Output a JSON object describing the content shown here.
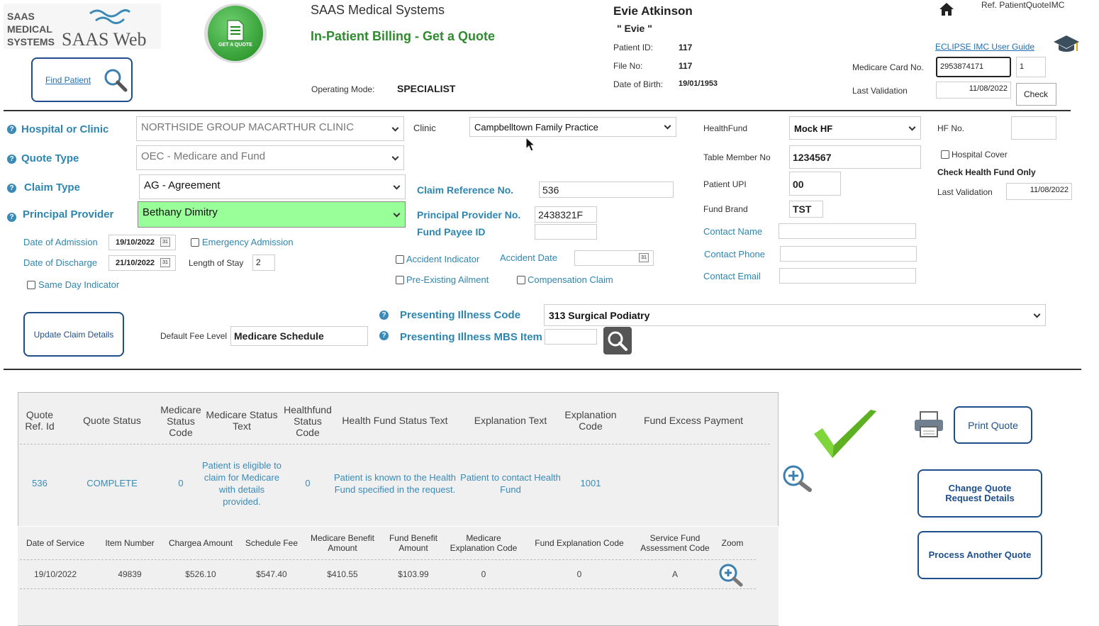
{
  "branding": {
    "logo_line1": "SAAS",
    "logo_line2": "MEDICAL",
    "logo_line3": "SYSTEMS",
    "logo_web": "SAAS Web",
    "badge_text": "GET A QUOTE"
  },
  "header": {
    "company": "SAAS Medical Systems",
    "page_title": "In-Patient Billing - Get a Quote",
    "operating_mode_label": "Operating Mode:",
    "operating_mode": "SPECIALIST",
    "find_patient": "Find Patient",
    "ref": "Ref. PatientQuoteIMC",
    "user_guide": "ECLIPSE IMC User Guide"
  },
  "patient": {
    "name": "Evie Atkinson",
    "nickname": "\" Evie \"",
    "id_label": "Patient ID:",
    "id": "117",
    "file_label": "File No:",
    "file": "117",
    "dob_label": "Date of Birth:",
    "dob": "19/01/1953",
    "medicare_label": "Medicare Card No.",
    "medicare": "2953874171",
    "medicare_irn": "1",
    "last_validation_label": "Last Validation",
    "last_validation": "11/08/2022",
    "check_label": "Check"
  },
  "form": {
    "hospital_label": "Hospital or Clinic",
    "hospital": "NORTHSIDE GROUP MACARTHUR CLINIC",
    "clinic_label": "Clinic",
    "clinic": "Campbelltown Family Practice",
    "quote_type_label": "Quote Type",
    "quote_type": "OEC - Medicare and Fund",
    "claim_type_label": "Claim Type",
    "claim_type": "AG - Agreement",
    "principal_provider_label": "Principal Provider",
    "principal_provider": "Bethany Dimitry",
    "claim_ref_label": "Claim Reference No.",
    "claim_ref": "536",
    "pp_no_label": "Principal Provider No.",
    "pp_no": "2438321F",
    "fund_payee_label": "Fund Payee ID",
    "fund_payee": "",
    "admission_label": "Date of Admission",
    "admission": "19/10/2022",
    "discharge_label": "Date of Discharge",
    "discharge": "21/10/2022",
    "emergency_label": "Emergency Admission",
    "los_label": "Length of Stay",
    "los": "2",
    "same_day_label": "Same Day Indicator",
    "accident_indicator_label": "Accident Indicator",
    "accident_date_label": "Accident Date",
    "pre_existing_label": "Pre-Existing Ailment",
    "compensation_label": "Compensation Claim",
    "update_claim": "Update Claim Details",
    "default_fee_label": "Default Fee Level",
    "default_fee": "Medicare Schedule",
    "illness_code_label": "Presenting Illness Code",
    "illness_code": "313 Surgical Podiatry",
    "illness_mbs_label": "Presenting Illness MBS Item",
    "illness_mbs": "",
    "calendar_glyph": "31"
  },
  "fund": {
    "healthfund_label": "HealthFund",
    "healthfund": "Mock HF",
    "hf_no_label": "HF No.",
    "hf_no": "",
    "table_member_label": "Table Member No",
    "table_member": "1234567",
    "hospital_cover_label": "Hospital Cover",
    "check_hf_only": "Check Health Fund Only",
    "upi_label": "Patient UPI",
    "upi": "00",
    "last_validation_label": "Last Validation",
    "last_validation": "11/08/2022",
    "brand_label": "Fund Brand",
    "brand": "TST",
    "contact_name_label": "Contact Name",
    "contact_phone_label": "Contact Phone",
    "contact_email_label": "Contact Email"
  },
  "quote_table": {
    "headers": [
      "Quote Ref. Id",
      "Quote Status",
      "Medicare Status Code",
      "Medicare Status Text",
      "Healthfund Status Code",
      "Health Fund Status Text",
      "Explanation Text",
      "Explanation Code",
      "Fund Excess Payment"
    ],
    "row": [
      "536",
      "COMPLETE",
      "0",
      "Patient is eligible to claim for Medicare with details provided.",
      "0",
      "Patient is known to the Health Fund specified in the request.",
      "Patient to contact Health Fund",
      "1001",
      ""
    ]
  },
  "service_table": {
    "headers": [
      "Date of Service",
      "Item Number",
      "Chargea Amount",
      "Schedule Fee",
      "Medicare Benefit Amount",
      "Fund Benefit Amount",
      "Medicare Explanation Code",
      "Fund Explanation Code",
      "Service Fund Assessment Code",
      "Zoom"
    ],
    "row": [
      "19/10/2022",
      "49839",
      "$526.10",
      "$547.40",
      "$410.55",
      "$103.99",
      "0",
      "0",
      "A"
    ]
  },
  "actions": {
    "print_quote": "Print Quote",
    "change_request": "Change Quote Request Details",
    "process_another": "Process Another Quote"
  },
  "colors": {
    "accent": "#2e86b0",
    "title_green": "#2e8b2e",
    "provider_bg": "#99ff99",
    "button_border": "#1f4f8a"
  }
}
